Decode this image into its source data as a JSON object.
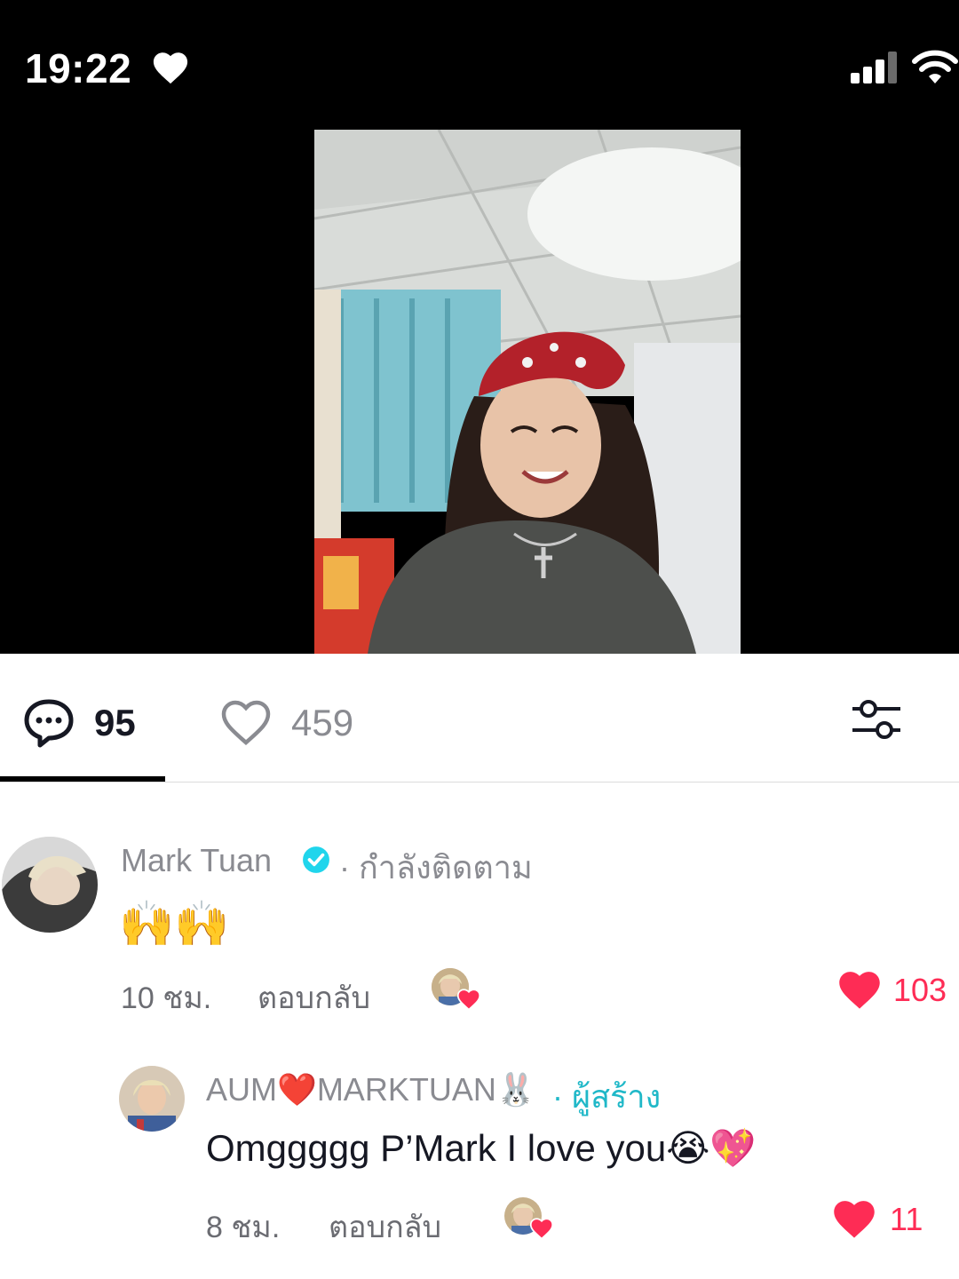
{
  "status_bar": {
    "time": "19:22",
    "icons": [
      "heart-icon",
      "signal-icon",
      "wifi-icon"
    ]
  },
  "video": {
    "description_icon": "video-frame"
  },
  "tabs": {
    "comments_count": "95",
    "likes_count": "459",
    "active": "comments"
  },
  "colors": {
    "accent_like": "#fe2c55",
    "verified": "#20d5ec",
    "creator": "#20b8c8",
    "text_primary": "#161823",
    "text_secondary": "#8a8b91"
  },
  "comments": [
    {
      "username": "Mark Tuan",
      "verified": true,
      "relation": "· กำลังติดตาม",
      "text": "🙌🙌",
      "time": "10 ชม.",
      "reply_label": "ตอบกลับ",
      "likes": "103",
      "liked_by_creator": true
    },
    {
      "username": "AUM❤️MARKTUAN🐰",
      "relation": "· ผู้สร้าง",
      "text": "Omggggg P’Mark I love you😭💖",
      "time": "8 ชม.",
      "reply_label": "ตอบกลับ",
      "likes": "11",
      "liked_by_creator": true
    }
  ]
}
